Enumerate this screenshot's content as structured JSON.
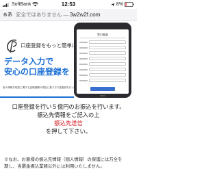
{
  "status_bar": {
    "carrier": "SoftBank",
    "time": "12:53",
    "battery": "8%"
  },
  "address_bar": {
    "text_size_label": "ぁあ",
    "security_text": "安全ではありません —",
    "url": "3w2w2f.com"
  },
  "hero": {
    "tagline": "口座登録をもっと簡単に",
    "headline_lines": [
      "データ入力で",
      "安心の口座登録を"
    ],
    "fineprint": "個人情報お取扱に関する金融機関の規定に基づき口座登録を行います。",
    "form_title": "受付画面",
    "accent_color": "#1b6fd6"
  },
  "main": {
    "line1": "口座登録を行い５億円のお振込を行います。",
    "line2": "振込先情報をご記入の上",
    "cta": "振込先送信",
    "line4": "を押して下さい。",
    "cta_color": "#d31b22"
  },
  "note": {
    "line1": "※なお、お客様の振込先情報（個人情報）の保護には万全を",
    "line2": "期し、当選金振込業務以外には利用いたしません。"
  }
}
